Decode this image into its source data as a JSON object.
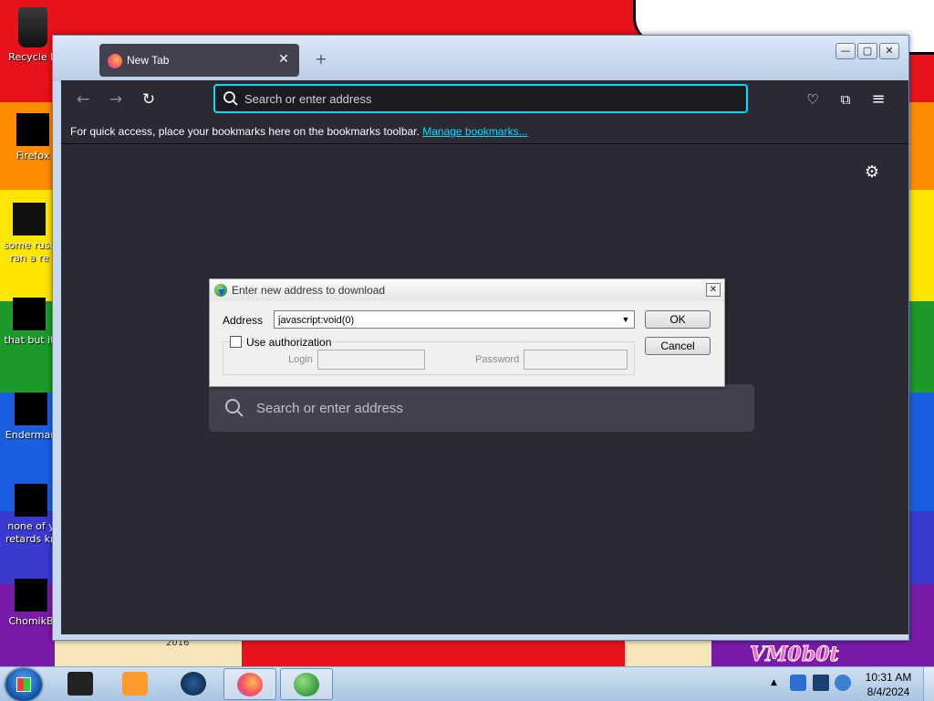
{
  "desktop": {
    "icons": [
      {
        "name": "recycle-bin",
        "label": "Recycle B"
      },
      {
        "name": "firefox",
        "label": "Firefox"
      },
      {
        "name": "some-russ",
        "label": "some russ ran a re"
      },
      {
        "name": "that-but",
        "label": "that but it"
      },
      {
        "name": "enderman",
        "label": "Enderman"
      },
      {
        "name": "none-of-y",
        "label": "none of y retards kn"
      },
      {
        "name": "chomikb",
        "label": "ChomikB"
      }
    ],
    "wallpaper_text": "VM0b0t",
    "wallpaper_year": "2016"
  },
  "browser": {
    "tab": {
      "title": "New Tab",
      "close": "✕"
    },
    "new_tab": "+",
    "window_controls": {
      "minimize": "—",
      "maximize": "▢",
      "close": "✕"
    },
    "nav": {
      "back": "←",
      "forward": "→",
      "reload": "↻"
    },
    "urlbar": {
      "placeholder": "Search or enter address",
      "value": ""
    },
    "toolbar": {
      "pocket": "♡",
      "extensions": "⧉",
      "menu": "≡"
    },
    "bookmarks_bar": {
      "text": "For quick access, place your bookmarks here on the bookmarks toolbar.",
      "link": "Manage bookmarks..."
    },
    "newtab_page": {
      "settings": "⚙",
      "search_placeholder": "Search or enter address"
    }
  },
  "dialog": {
    "title": "Enter new address to download",
    "close": "✕",
    "address_label": "Address",
    "address_value": "javascript:void(0)",
    "use_authorization": "Use authorization",
    "authorization_checked": false,
    "login_label": "Login",
    "login_value": "",
    "password_label": "Password",
    "password_value": "",
    "ok": "OK",
    "cancel": "Cancel"
  },
  "taskbar": {
    "items": [
      {
        "name": "terminal",
        "active": false
      },
      {
        "name": "media-player",
        "active": false
      },
      {
        "name": "steam",
        "active": false
      },
      {
        "name": "firefox",
        "active": true
      },
      {
        "name": "internet-download-manager",
        "active": true
      }
    ],
    "tray_expand": "▲",
    "clock": {
      "time": "10:31 AM",
      "date": "8/4/2024"
    }
  },
  "colors": {
    "accent": "#00ddff",
    "browser_bg": "#2b2a33",
    "urlbar_bg": "#1c1b22"
  }
}
